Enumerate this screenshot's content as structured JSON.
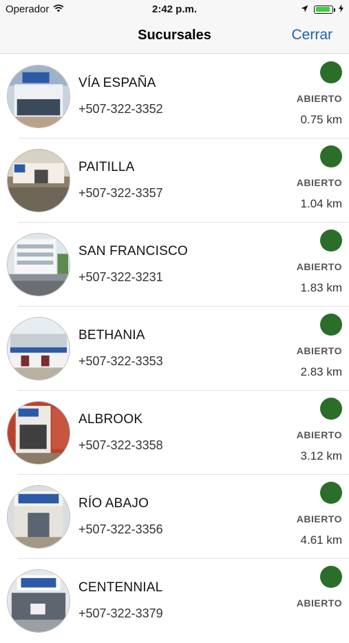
{
  "status_bar": {
    "carrier": "Operador",
    "time": "2:42 p.m."
  },
  "nav": {
    "title": "Sucursales",
    "close_label": "Cerrar"
  },
  "colors": {
    "accent": "#1f5fa8",
    "open_status": "#2a6e2a"
  },
  "branches": [
    {
      "name": "VÍA ESPAÑA",
      "phone": "+507-322-3352",
      "status": "ABIERTO",
      "distance": "0.75 km"
    },
    {
      "name": "PAITILLA",
      "phone": "+507-322-3357",
      "status": "ABIERTO",
      "distance": "1.04 km"
    },
    {
      "name": "SAN FRANCISCO",
      "phone": "+507-322-3231",
      "status": "ABIERTO",
      "distance": "1.83 km"
    },
    {
      "name": "BETHANIA",
      "phone": "+507-322-3353",
      "status": "ABIERTO",
      "distance": "2.83 km"
    },
    {
      "name": "ALBROOK",
      "phone": "+507-322-3358",
      "status": "ABIERTO",
      "distance": "3.12 km"
    },
    {
      "name": "RÍO ABAJO",
      "phone": "+507-322-3356",
      "status": "ABIERTO",
      "distance": "4.61 km"
    },
    {
      "name": "CENTENNIAL",
      "phone": "+507-322-3379",
      "status": "ABIERTO",
      "distance": ""
    }
  ]
}
